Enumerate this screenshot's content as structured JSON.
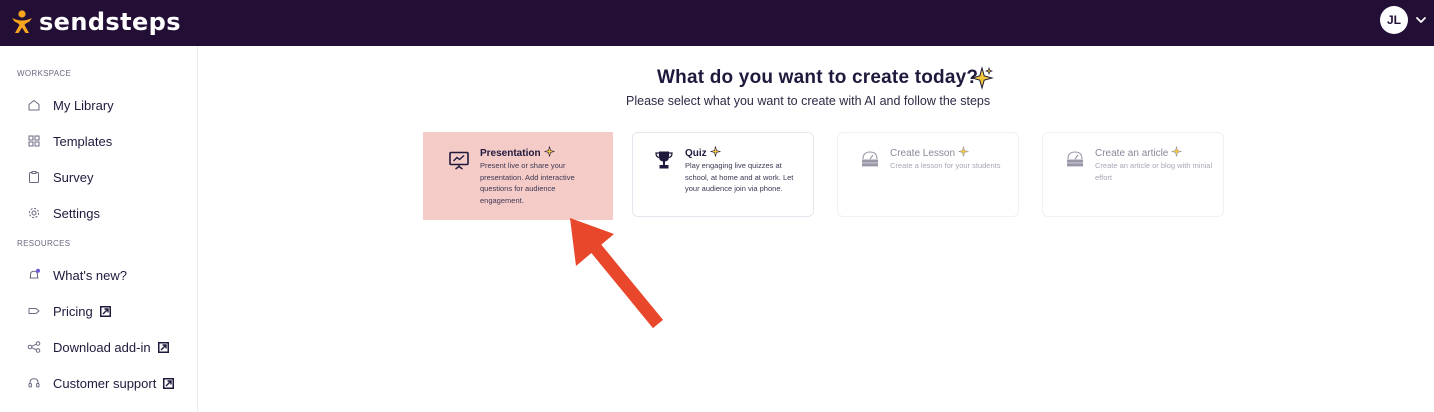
{
  "app": {
    "logo_text": "sendsteps"
  },
  "user": {
    "initials": "JL"
  },
  "sidebar": {
    "workspace_label": "WORKSPACE",
    "resources_label": "RESOURCES",
    "workspace_items": [
      {
        "label": "My Library",
        "icon": "home-icon"
      },
      {
        "label": "Templates",
        "icon": "grid-icon"
      },
      {
        "label": "Survey",
        "icon": "clipboard-icon"
      },
      {
        "label": "Settings",
        "icon": "gear-icon"
      }
    ],
    "resource_items": [
      {
        "label": "What's new?",
        "icon": "bell-icon"
      },
      {
        "label": "Pricing",
        "icon": "tag-icon"
      },
      {
        "label": "Download add-in",
        "icon": "share-icon"
      },
      {
        "label": "Customer support",
        "icon": "headset-icon"
      }
    ]
  },
  "main": {
    "title": "What do you want to create today?",
    "subtitle": "Please select what you want to create with AI and follow the steps",
    "cards": [
      {
        "title": "Presentation",
        "description": "Present live or share your presentation. Add interactive questions for audience engagement.",
        "icon": "presentation-icon",
        "state": "selected"
      },
      {
        "title": "Quiz",
        "description": "Play engaging live quizzes at school, at home and at work. Let your audience join via phone.",
        "icon": "trophy-icon",
        "state": "enabled"
      },
      {
        "title": "Create Lesson",
        "description": "Create a lesson for your students",
        "icon": "coming-soon-icon",
        "state": "disabled"
      },
      {
        "title": "Create an article",
        "description": "Create an article or blog with minial effort",
        "icon": "coming-soon-icon",
        "state": "disabled"
      }
    ]
  },
  "colors": {
    "topbar": "#230f36",
    "selected_card": "#f5cbc7",
    "arrow": "#e8472b",
    "logo_accent": "#f7a51c"
  }
}
